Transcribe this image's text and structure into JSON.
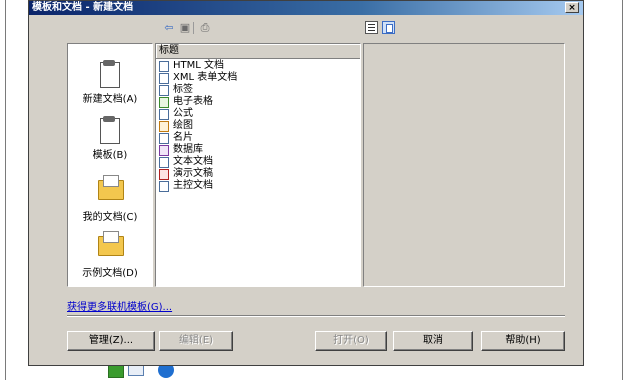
{
  "dialog": {
    "title": "模板和文档 - 新建文档",
    "close_label": "×"
  },
  "toolbar": {
    "back_icon": "back-arrow-icon",
    "up_icon": "folder-up-icon",
    "print_icon": "print-icon",
    "back_glyph": "⇦",
    "up_glyph": "▣",
    "print_glyph": "⎙"
  },
  "categories": [
    {
      "label": "新建文档(A)",
      "icon": "new-document-icon",
      "selected": true
    },
    {
      "label": "模板(B)",
      "icon": "templates-icon",
      "selected": false
    },
    {
      "label": "我的文档(C)",
      "icon": "my-documents-folder-icon",
      "selected": false
    },
    {
      "label": "示例文档(D)",
      "icon": "sample-documents-folder-icon",
      "selected": false
    }
  ],
  "list": {
    "header": "标题",
    "items": [
      {
        "label": "HTML 文档",
        "icon": "html-document-icon"
      },
      {
        "label": "XML 表单文档",
        "icon": "xml-form-document-icon"
      },
      {
        "label": "标签",
        "icon": "labels-icon"
      },
      {
        "label": "电子表格",
        "icon": "spreadsheet-icon"
      },
      {
        "label": "公式",
        "icon": "formula-icon"
      },
      {
        "label": "绘图",
        "icon": "drawing-icon"
      },
      {
        "label": "名片",
        "icon": "business-card-icon"
      },
      {
        "label": "数据库",
        "icon": "database-icon"
      },
      {
        "label": "文本文档",
        "icon": "text-document-icon"
      },
      {
        "label": "演示文稿",
        "icon": "presentation-icon"
      },
      {
        "label": "主控文档",
        "icon": "master-document-icon"
      }
    ]
  },
  "more_templates_link": "获得更多联机模板(G)...",
  "buttons": {
    "manage": "管理(Z)...",
    "edit": "编辑(E)",
    "open": "打开(O)",
    "cancel": "取消",
    "help": "帮助(H)"
  },
  "colors": {
    "title_bar": "#0a246a",
    "dialog_bg": "#d4d0c8",
    "selection": "#0a246a",
    "link": "#0000cc"
  }
}
